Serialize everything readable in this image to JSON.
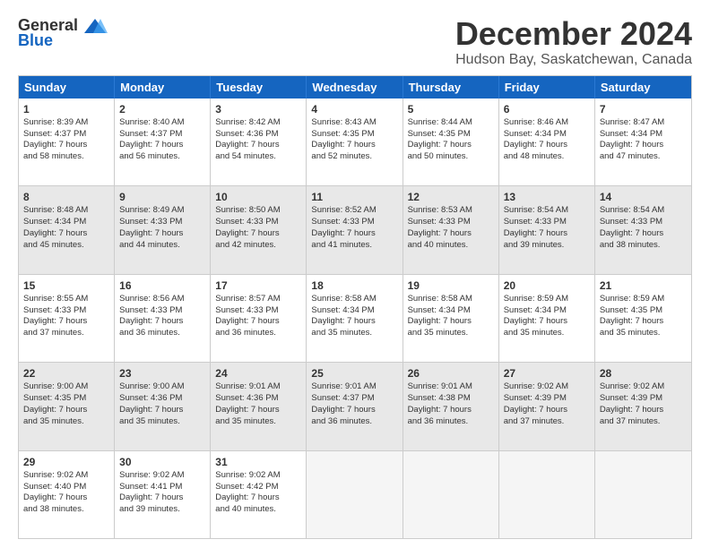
{
  "logo": {
    "general": "General",
    "blue": "Blue"
  },
  "title": "December 2024",
  "subtitle": "Hudson Bay, Saskatchewan, Canada",
  "weekdays": [
    "Sunday",
    "Monday",
    "Tuesday",
    "Wednesday",
    "Thursday",
    "Friday",
    "Saturday"
  ],
  "rows": [
    [
      {
        "day": "1",
        "lines": [
          "Sunrise: 8:39 AM",
          "Sunset: 4:37 PM",
          "Daylight: 7 hours",
          "and 58 minutes."
        ]
      },
      {
        "day": "2",
        "lines": [
          "Sunrise: 8:40 AM",
          "Sunset: 4:37 PM",
          "Daylight: 7 hours",
          "and 56 minutes."
        ]
      },
      {
        "day": "3",
        "lines": [
          "Sunrise: 8:42 AM",
          "Sunset: 4:36 PM",
          "Daylight: 7 hours",
          "and 54 minutes."
        ]
      },
      {
        "day": "4",
        "lines": [
          "Sunrise: 8:43 AM",
          "Sunset: 4:35 PM",
          "Daylight: 7 hours",
          "and 52 minutes."
        ]
      },
      {
        "day": "5",
        "lines": [
          "Sunrise: 8:44 AM",
          "Sunset: 4:35 PM",
          "Daylight: 7 hours",
          "and 50 minutes."
        ]
      },
      {
        "day": "6",
        "lines": [
          "Sunrise: 8:46 AM",
          "Sunset: 4:34 PM",
          "Daylight: 7 hours",
          "and 48 minutes."
        ]
      },
      {
        "day": "7",
        "lines": [
          "Sunrise: 8:47 AM",
          "Sunset: 4:34 PM",
          "Daylight: 7 hours",
          "and 47 minutes."
        ]
      }
    ],
    [
      {
        "day": "8",
        "lines": [
          "Sunrise: 8:48 AM",
          "Sunset: 4:34 PM",
          "Daylight: 7 hours",
          "and 45 minutes."
        ]
      },
      {
        "day": "9",
        "lines": [
          "Sunrise: 8:49 AM",
          "Sunset: 4:33 PM",
          "Daylight: 7 hours",
          "and 44 minutes."
        ]
      },
      {
        "day": "10",
        "lines": [
          "Sunrise: 8:50 AM",
          "Sunset: 4:33 PM",
          "Daylight: 7 hours",
          "and 42 minutes."
        ]
      },
      {
        "day": "11",
        "lines": [
          "Sunrise: 8:52 AM",
          "Sunset: 4:33 PM",
          "Daylight: 7 hours",
          "and 41 minutes."
        ]
      },
      {
        "day": "12",
        "lines": [
          "Sunrise: 8:53 AM",
          "Sunset: 4:33 PM",
          "Daylight: 7 hours",
          "and 40 minutes."
        ]
      },
      {
        "day": "13",
        "lines": [
          "Sunrise: 8:54 AM",
          "Sunset: 4:33 PM",
          "Daylight: 7 hours",
          "and 39 minutes."
        ]
      },
      {
        "day": "14",
        "lines": [
          "Sunrise: 8:54 AM",
          "Sunset: 4:33 PM",
          "Daylight: 7 hours",
          "and 38 minutes."
        ]
      }
    ],
    [
      {
        "day": "15",
        "lines": [
          "Sunrise: 8:55 AM",
          "Sunset: 4:33 PM",
          "Daylight: 7 hours",
          "and 37 minutes."
        ]
      },
      {
        "day": "16",
        "lines": [
          "Sunrise: 8:56 AM",
          "Sunset: 4:33 PM",
          "Daylight: 7 hours",
          "and 36 minutes."
        ]
      },
      {
        "day": "17",
        "lines": [
          "Sunrise: 8:57 AM",
          "Sunset: 4:33 PM",
          "Daylight: 7 hours",
          "and 36 minutes."
        ]
      },
      {
        "day": "18",
        "lines": [
          "Sunrise: 8:58 AM",
          "Sunset: 4:34 PM",
          "Daylight: 7 hours",
          "and 35 minutes."
        ]
      },
      {
        "day": "19",
        "lines": [
          "Sunrise: 8:58 AM",
          "Sunset: 4:34 PM",
          "Daylight: 7 hours",
          "and 35 minutes."
        ]
      },
      {
        "day": "20",
        "lines": [
          "Sunrise: 8:59 AM",
          "Sunset: 4:34 PM",
          "Daylight: 7 hours",
          "and 35 minutes."
        ]
      },
      {
        "day": "21",
        "lines": [
          "Sunrise: 8:59 AM",
          "Sunset: 4:35 PM",
          "Daylight: 7 hours",
          "and 35 minutes."
        ]
      }
    ],
    [
      {
        "day": "22",
        "lines": [
          "Sunrise: 9:00 AM",
          "Sunset: 4:35 PM",
          "Daylight: 7 hours",
          "and 35 minutes."
        ]
      },
      {
        "day": "23",
        "lines": [
          "Sunrise: 9:00 AM",
          "Sunset: 4:36 PM",
          "Daylight: 7 hours",
          "and 35 minutes."
        ]
      },
      {
        "day": "24",
        "lines": [
          "Sunrise: 9:01 AM",
          "Sunset: 4:36 PM",
          "Daylight: 7 hours",
          "and 35 minutes."
        ]
      },
      {
        "day": "25",
        "lines": [
          "Sunrise: 9:01 AM",
          "Sunset: 4:37 PM",
          "Daylight: 7 hours",
          "and 36 minutes."
        ]
      },
      {
        "day": "26",
        "lines": [
          "Sunrise: 9:01 AM",
          "Sunset: 4:38 PM",
          "Daylight: 7 hours",
          "and 36 minutes."
        ]
      },
      {
        "day": "27",
        "lines": [
          "Sunrise: 9:02 AM",
          "Sunset: 4:39 PM",
          "Daylight: 7 hours",
          "and 37 minutes."
        ]
      },
      {
        "day": "28",
        "lines": [
          "Sunrise: 9:02 AM",
          "Sunset: 4:39 PM",
          "Daylight: 7 hours",
          "and 37 minutes."
        ]
      }
    ],
    [
      {
        "day": "29",
        "lines": [
          "Sunrise: 9:02 AM",
          "Sunset: 4:40 PM",
          "Daylight: 7 hours",
          "and 38 minutes."
        ]
      },
      {
        "day": "30",
        "lines": [
          "Sunrise: 9:02 AM",
          "Sunset: 4:41 PM",
          "Daylight: 7 hours",
          "and 39 minutes."
        ]
      },
      {
        "day": "31",
        "lines": [
          "Sunrise: 9:02 AM",
          "Sunset: 4:42 PM",
          "Daylight: 7 hours",
          "and 40 minutes."
        ]
      },
      null,
      null,
      null,
      null
    ]
  ]
}
